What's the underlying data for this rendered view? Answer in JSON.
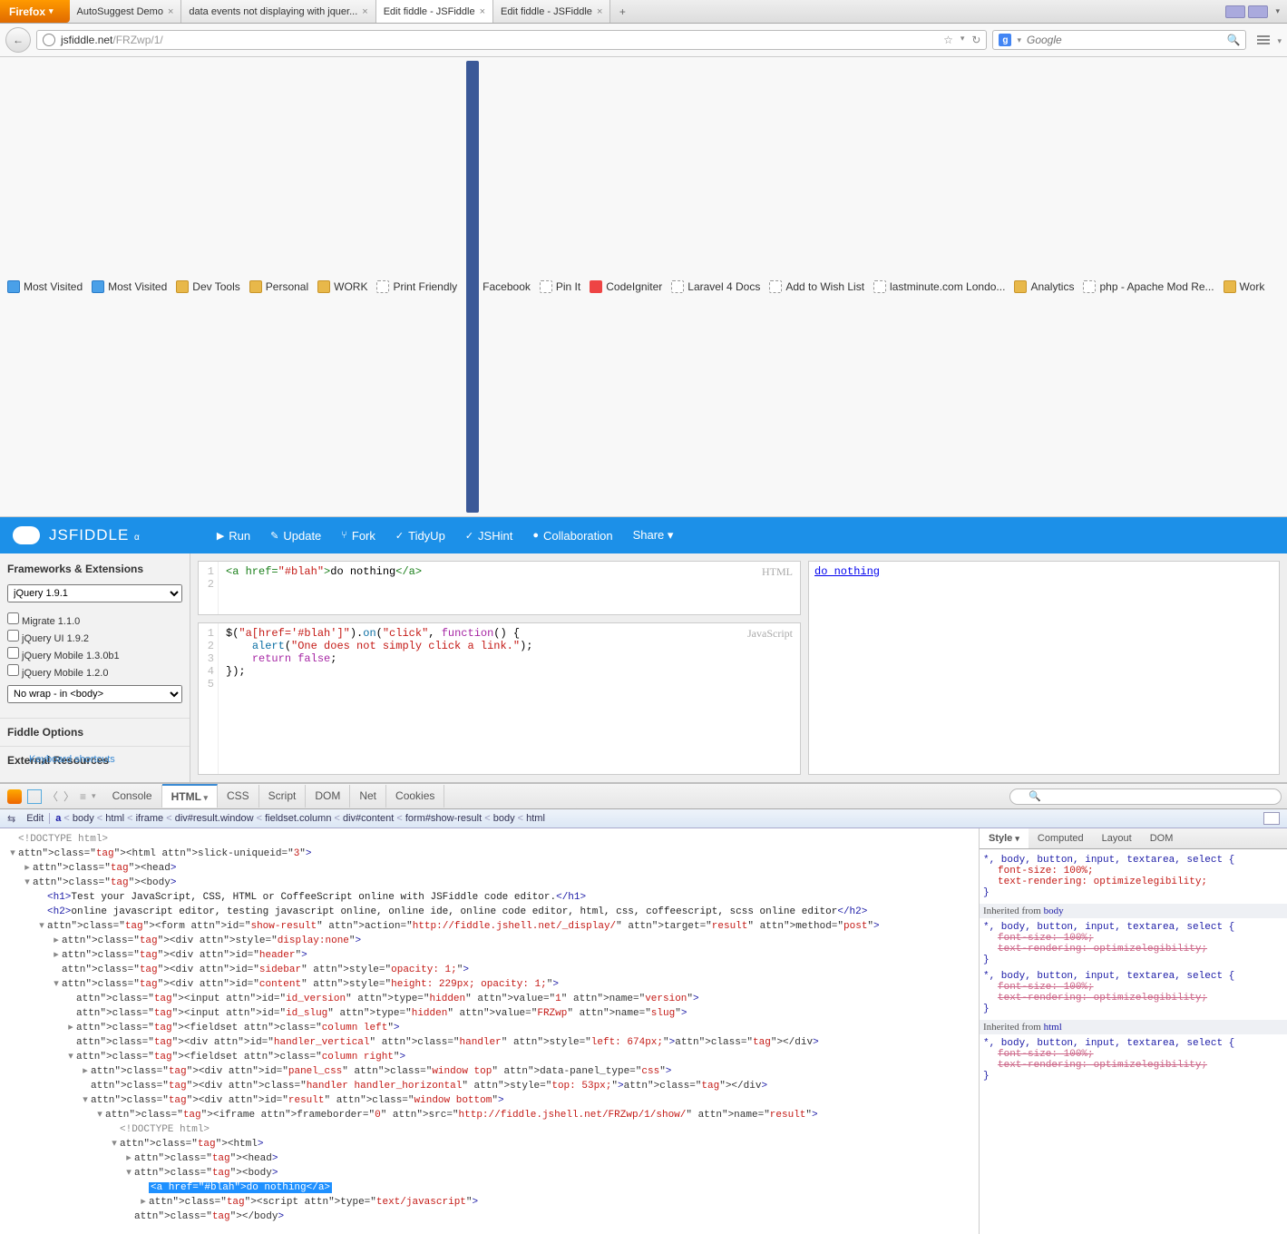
{
  "browser": {
    "button": "Firefox",
    "tabs": [
      {
        "title": "AutoSuggest Demo",
        "active": false
      },
      {
        "title": "data events not displaying with jquer...",
        "active": false
      },
      {
        "title": "Edit fiddle - JSFiddle",
        "active": true
      },
      {
        "title": "Edit fiddle - JSFiddle",
        "active": false
      }
    ],
    "url_host": "jsfiddle.net",
    "url_path": "/FRZwp/1/",
    "search_placeholder": "Google",
    "bookmarks": [
      {
        "label": "Most Visited",
        "ico": "blue"
      },
      {
        "label": "Most Visited",
        "ico": "blue"
      },
      {
        "label": "Dev Tools",
        "ico": "folder"
      },
      {
        "label": "Personal",
        "ico": "folder"
      },
      {
        "label": "WORK",
        "ico": "folder"
      },
      {
        "label": "Print Friendly",
        "ico": "box"
      },
      {
        "label": "Facebook",
        "ico": "fb"
      },
      {
        "label": "Pin It",
        "ico": "box"
      },
      {
        "label": "CodeIgniter",
        "ico": "ci"
      },
      {
        "label": "Laravel 4 Docs",
        "ico": "box"
      },
      {
        "label": "Add to Wish List",
        "ico": "box"
      },
      {
        "label": "lastminute.com Londo...",
        "ico": "box"
      },
      {
        "label": "Analytics",
        "ico": "folder"
      },
      {
        "label": "php - Apache Mod Re...",
        "ico": "box"
      },
      {
        "label": "Work",
        "ico": "folder"
      }
    ]
  },
  "jsfiddle": {
    "title": "JSFIDDLE",
    "alpha": "α",
    "actions": [
      "Run",
      "Update",
      "Fork",
      "TidyUp",
      "JSHint",
      "Collaboration",
      "Share"
    ],
    "sidebar": {
      "frameworks_heading": "Frameworks & Extensions",
      "framework_select": "jQuery 1.9.1",
      "extensions": [
        "Migrate 1.1.0",
        "jQuery UI 1.9.2",
        "jQuery Mobile 1.3.0b1",
        "jQuery Mobile 1.2.0"
      ],
      "wrap_select": "No wrap - in <body>",
      "options_heading": "Fiddle Options",
      "external_heading": "External Resources",
      "keyboard_hint": "Keyboard shortcuts"
    },
    "html_panel": {
      "label": "HTML",
      "code": "<a href=\"#blah\">do nothing</a>"
    },
    "js_panel": {
      "label": "JavaScript",
      "lines": [
        "$(\"a[href='#blah']\").on(\"click\", function() {",
        "    alert(\"One does not simply click a link.\");",
        "    return false;",
        "});",
        ""
      ]
    },
    "result_text": "do nothing"
  },
  "firebug": {
    "tabs": [
      "Console",
      "HTML",
      "CSS",
      "Script",
      "DOM",
      "Net",
      "Cookies"
    ],
    "active_tab": "HTML",
    "edit_label": "Edit",
    "breadcrumb": [
      "a",
      "body",
      "html",
      "iframe",
      "div#result.window",
      "fieldset.column",
      "div#content",
      "form#show-result",
      "body",
      "html"
    ],
    "htmltree": {
      "doctype": "<!DOCTYPE html>",
      "html_open": "<html slick-uniqueid=\"3\">",
      "head": "<head>",
      "body": "<body>",
      "h1": "Test your JavaScript, CSS, HTML or CoffeeScript online with JSFiddle code editor.",
      "h2": "online javascript editor, testing javascript online, online ide, online code editor, html, css, coffeescript, scss online editor",
      "form": "<form id=\"show-result\" action=\"http://fiddle.jshell.net/_display/\" target=\"result\" method=\"post\">",
      "div_dn": "<div style=\"display:none\">",
      "div_header": "<div id=\"header\">",
      "div_sidebar": "<div id=\"sidebar\" style=\"opacity: 1;\">",
      "div_content": "<div id=\"content\" style=\"height: 229px; opacity: 1;\">",
      "input_ver": "<input id=\"id_version\" type=\"hidden\" value=\"1\" name=\"version\">",
      "input_slug": "<input id=\"id_slug\" type=\"hidden\" value=\"FRZwp\" name=\"slug\">",
      "fs_left": "<fieldset class=\"column left\">",
      "handler_v": "<div id=\"handler_vertical\" class=\"handler\" style=\"left: 674px;\"></div>",
      "fs_right": "<fieldset class=\"column right\">",
      "panel_css": "<div id=\"panel_css\" class=\"window top\" data-panel_type=\"css\">",
      "handler_h": "<div class=\"handler handler_horizontal\" style=\"top: 53px;\"></div>",
      "div_result": "<div id=\"result\" class=\"window bottom\">",
      "iframe": "<iframe frameborder=\"0\" src=\"http://fiddle.jshell.net/FRZwp/1/show/\" name=\"result\">",
      "doctype2": "<!DOCTYPE html>",
      "html2": "<html>",
      "head2": "<head>",
      "body2": "<body>",
      "highlighted": "<a href=\"#blah\">do nothing</a>",
      "script": "<script type=\"text/javascript\">",
      "body2_close": "</body>"
    },
    "style": {
      "tabs": [
        "Style",
        "Computed",
        "Layout",
        "DOM"
      ],
      "rule1_sel": "*, body, button, input, textarea, select {",
      "rule1_p1": "font-size: 100%;",
      "rule1_p2": "text-rendering: optimizelegibility;",
      "inh_body": "Inherited from body",
      "inh_html": "Inherited from html",
      "struck1": "font-size: 100%;",
      "struck2": "text-rendering: optimizelegibility;"
    }
  }
}
